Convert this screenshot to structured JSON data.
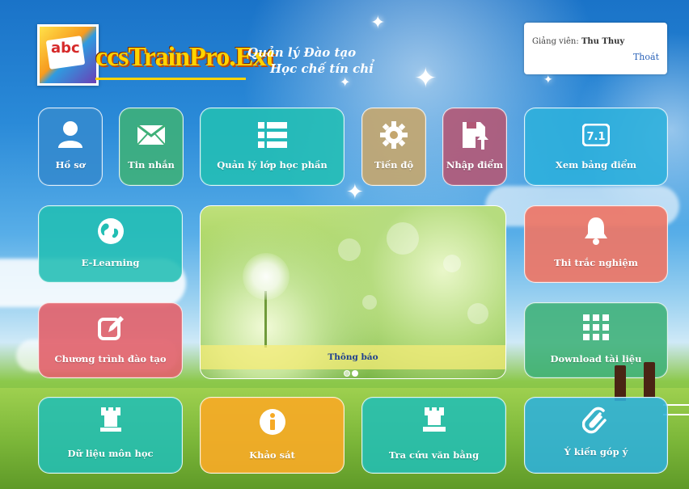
{
  "header": {
    "brand": "ccsTrainPro.Ext",
    "tagline_line1": "Quản lý Đào tạo",
    "tagline_line2": "Học chế tín chỉ",
    "logo_text": "abc"
  },
  "user": {
    "role_label": "Giảng viên:",
    "name": "Thu Thuy",
    "logout_label": "Thoát"
  },
  "tiles": {
    "profile": "Hồ sơ",
    "messages": "Tin nhắn",
    "class_management": "Quản lý lớp học phần",
    "progress": "Tiến độ",
    "enter_grades": "Nhập điểm",
    "view_grades": "Xem bảng điểm",
    "elearning": "E-Learning",
    "quiz": "Thi trắc nghiệm",
    "curriculum": "Chương trình đào tạo",
    "download": "Download tài liệu",
    "course_data": "Dữ liệu môn học",
    "survey": "Khảo sát",
    "diploma_lookup": "Tra cứu văn bằng",
    "feedback": "Ý kiến góp ý"
  },
  "slider": {
    "caption": "Thông báo",
    "active_slide": 2,
    "slide_count": 2
  },
  "icons": {
    "profile": "user-icon",
    "messages": "envelope-icon",
    "class_management": "list-icon",
    "progress": "gear-icon",
    "enter_grades": "save-upload-icon",
    "view_grades": "grade-card-icon",
    "elearning": "globe-icon",
    "quiz": "bell-icon",
    "curriculum": "edit-icon",
    "download": "grid-icon",
    "course_data": "tower-icon",
    "survey": "info-icon",
    "diploma_lookup": "certificate-icon",
    "feedback": "paperclip-icon"
  },
  "colors": {
    "brand": "#ffd400",
    "link": "#2a62b8"
  }
}
